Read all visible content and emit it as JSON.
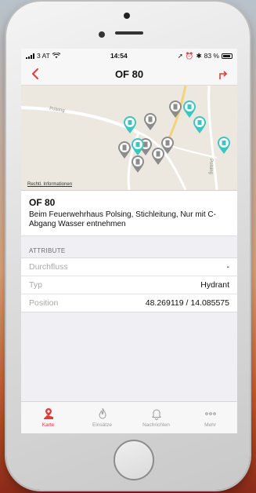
{
  "status": {
    "carrier": "3 AT",
    "time": "14:54",
    "battery": "83 %"
  },
  "nav": {
    "title": "OF 80"
  },
  "map": {
    "road_label_1": "Polsing",
    "road_label_2": "Polsing",
    "credit": "Rechtl. Informationen"
  },
  "info": {
    "name": "OF 80",
    "description": "Beim Feuerwehrhaus Polsing, Stichleitung, Nur mit C-Abgang Wasser entnehmen"
  },
  "attributes": {
    "header": "ATTRIBUTE",
    "rows": [
      {
        "key": "Durchfluss",
        "value": "-"
      },
      {
        "key": "Typ",
        "value": "Hydrant"
      },
      {
        "key": "Position",
        "value": "48.269119 / 14.085575"
      }
    ]
  },
  "tabs": [
    {
      "label": "Karte",
      "icon": "map-pin-icon",
      "active": true
    },
    {
      "label": "Einsätze",
      "icon": "flame-icon",
      "active": false
    },
    {
      "label": "Nachrichten",
      "icon": "bell-icon",
      "active": false
    },
    {
      "label": "Mehr",
      "icon": "more-icon",
      "active": false
    }
  ],
  "colors": {
    "accent": "#e23b3b",
    "hydrant_pin": "#3cc6c0",
    "building_pin": "#8c8c8c"
  }
}
